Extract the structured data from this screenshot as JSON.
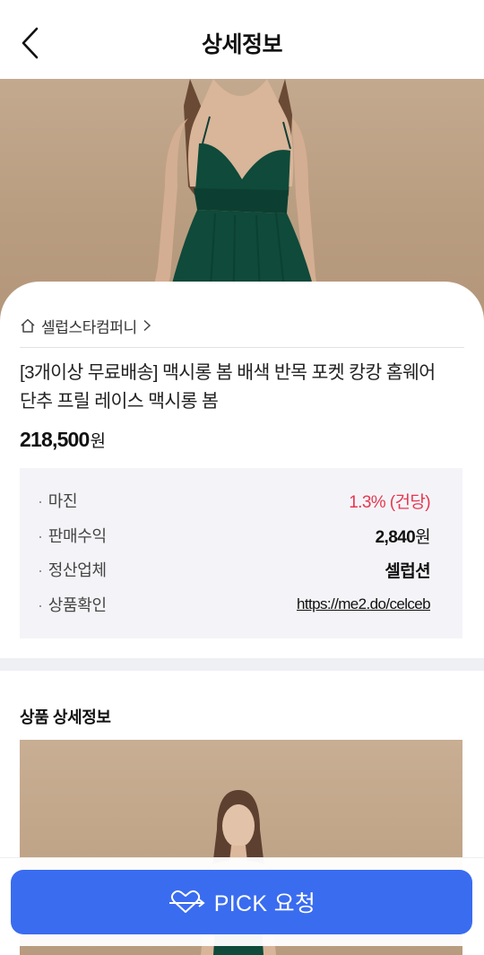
{
  "header": {
    "title": "상세정보"
  },
  "product": {
    "brand": "셀럽스타컴퍼니",
    "name": "[3개이상 무료배송] 맥시롱 봄 배색 반목 포켓 캉캉 홈웨어 단추 프릴 레이스 맥시롱 봄",
    "price": "218,500",
    "price_unit": "원"
  },
  "info": {
    "rows": [
      {
        "label": "마진",
        "value": "1.3% (건당)"
      },
      {
        "label": "판매수익",
        "value": "2,840",
        "unit": "원"
      },
      {
        "label": "정산업체",
        "value": "셀럽션"
      },
      {
        "label": "상품확인",
        "value": "https://me2.do/celceb"
      }
    ]
  },
  "detail": {
    "title": "상품 상세정보"
  },
  "cta": {
    "label": "PICK 요청"
  },
  "colors": {
    "accent": "#3a6cf0",
    "margin": "#e8364f",
    "dress": "#0f4a3a"
  },
  "icons": [
    "back-arrow-icon",
    "home-icon",
    "chevron-right-icon",
    "heart-arrow-icon"
  ]
}
